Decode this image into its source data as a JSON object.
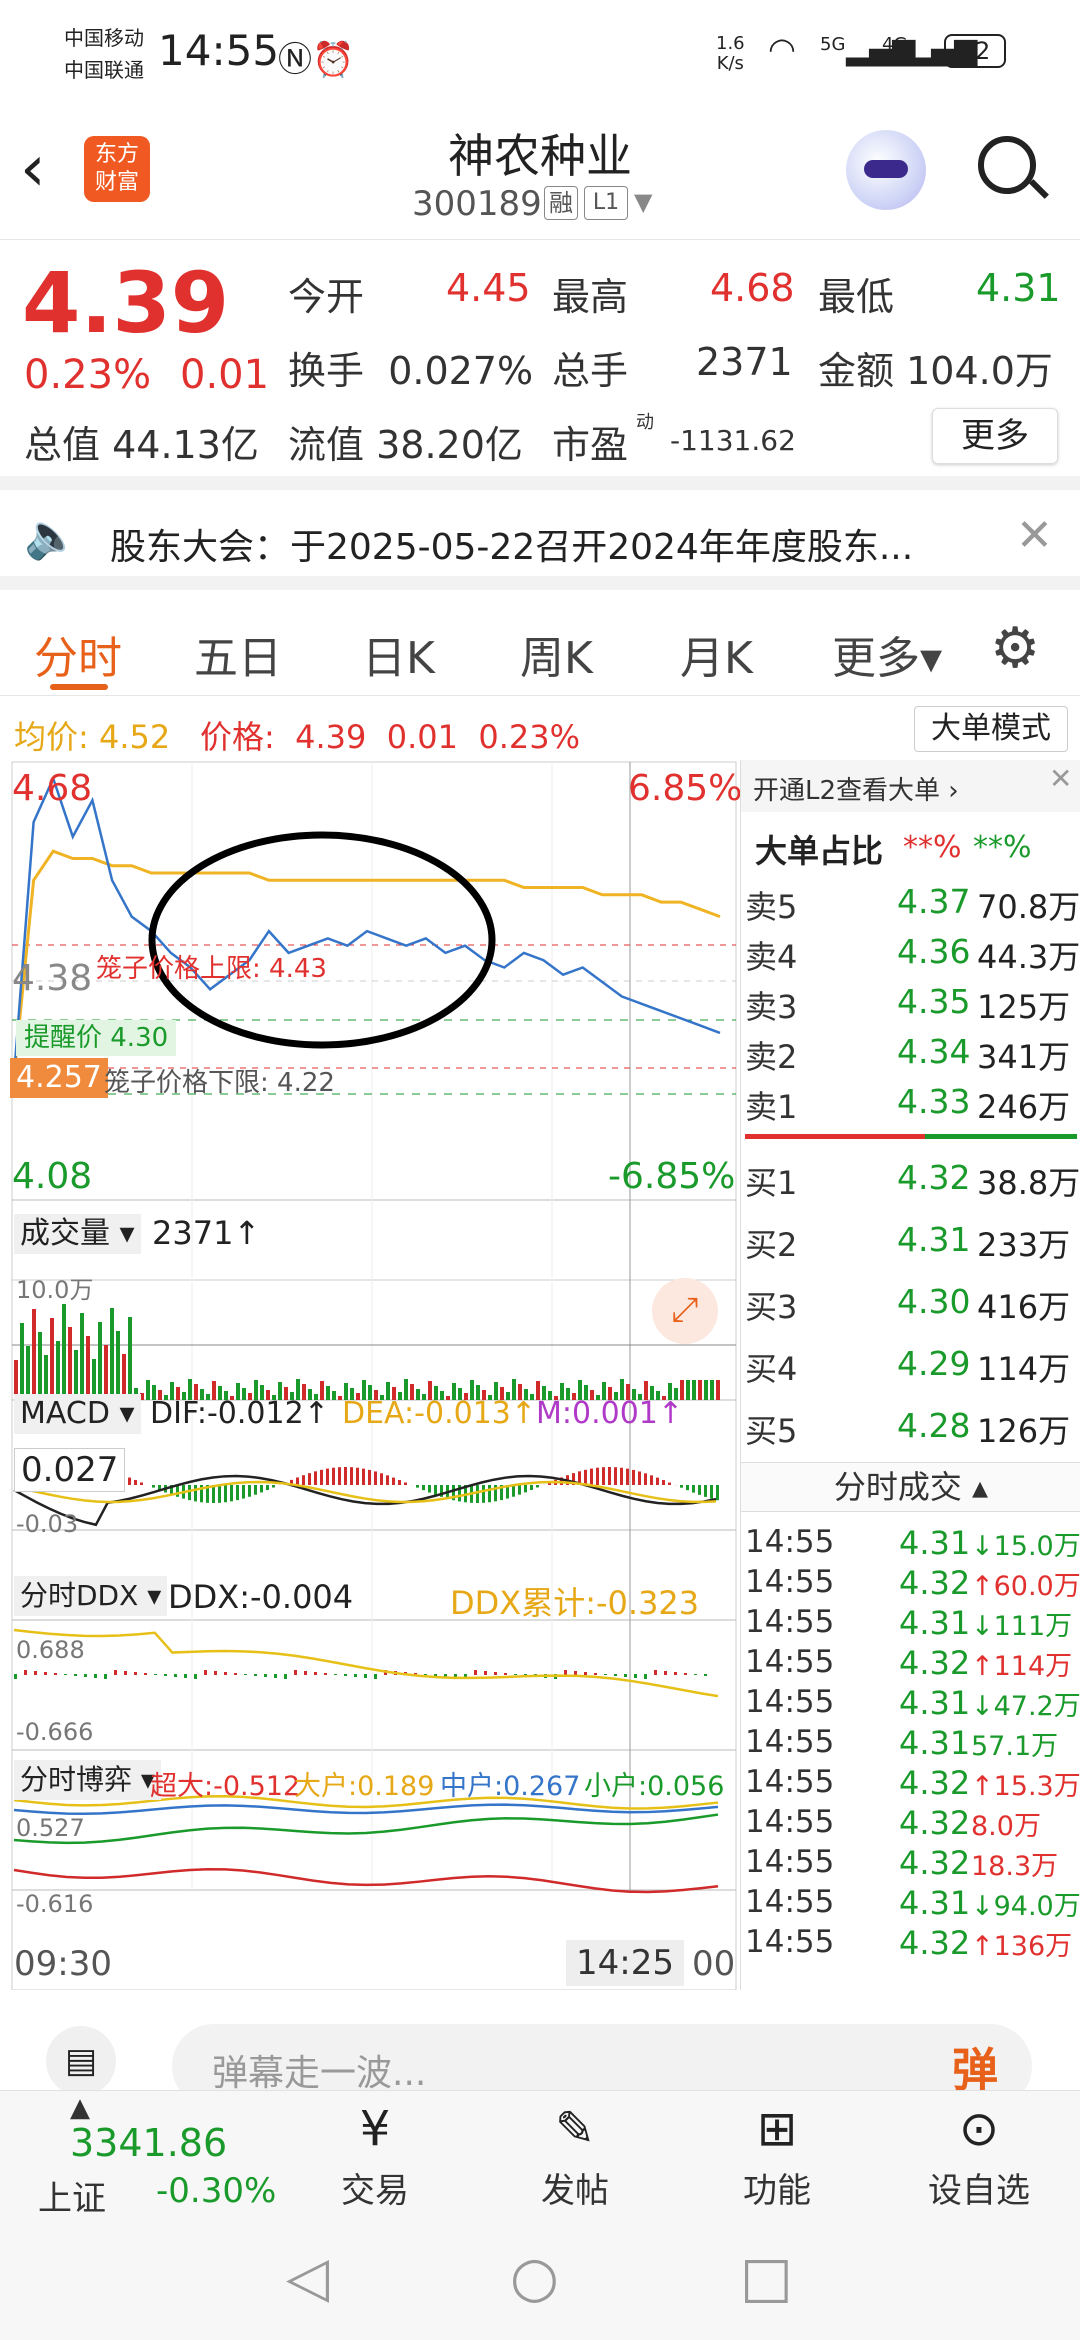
{
  "status": {
    "carrier1": "中国移动",
    "carrier2": "中国联通",
    "time": "14:55",
    "speed_top": "1.6",
    "speed_bottom": "K/s",
    "net1": "5G",
    "net2": "4G",
    "battery": "12"
  },
  "header": {
    "logo_line1": "东方",
    "logo_line2": "财富",
    "title": "神农种业",
    "code": "300189",
    "tag_rong": "融",
    "tag_l1": "L1"
  },
  "quote": {
    "price": "4.39",
    "pct": "0.23%",
    "chg": "0.01",
    "open_label": "今开",
    "open": "4.45",
    "high_label": "最高",
    "high": "4.68",
    "low_label": "最低",
    "low": "4.31",
    "turnover_label": "换手",
    "turnover": "0.027%",
    "volume_label": "总手",
    "volume": "2371",
    "amount_label": "金额",
    "amount": "104.0万",
    "mcap_label": "总值",
    "mcap": "44.13亿",
    "float_label": "流值",
    "float": "38.20亿",
    "pe_label": "市盈",
    "pe_sup": "动",
    "pe": "-1131.62",
    "more_label": "更多"
  },
  "notice": {
    "text": "股东大会：于2025-05-22召开2024年年度股东..."
  },
  "tabs": [
    "分时",
    "五日",
    "日K",
    "周K",
    "月K",
    "更多▾"
  ],
  "chart": {
    "avg_label": "均价:",
    "avg": "4.52",
    "price_label": "价格:",
    "price": "4.39",
    "chg": "0.01",
    "pct": "0.23%",
    "bigorder_btn": "大单模式",
    "y_top": "4.68",
    "y_mid": "4.38",
    "y_bot": "4.08",
    "pct_top": "6.85%",
    "pct_bot": "-6.85%",
    "cage_up": "笼子价格上限:  4.43",
    "cage_down": "笼子价格下限:  4.22",
    "alert": "提醒价 4.30",
    "current_tag": "4.257",
    "vol_label": "成交量",
    "vol_value": "2371↑",
    "vol_scale": "10.0万",
    "macd_label": "MACD",
    "dif": "DIF:-0.012↑",
    "dea": "DEA:-0.013↑",
    "m": "M:0.001↑",
    "macd_top": "0.027",
    "macd_bot": "-0.03",
    "ddx_label": "分时DDX",
    "ddx": "DDX:-0.004",
    "ddx_sum": "DDX累计:-0.323",
    "ddx_top": "0.688",
    "ddx_bot": "-0.666",
    "game_label": "分时博弈",
    "super": "超大:-0.512",
    "big": "大户:0.189",
    "mid": "中户:0.267",
    "small": "小户:0.056",
    "game_top": "0.527",
    "game_bot": "-0.616",
    "t_start": "09:30",
    "t_cross": "14:25",
    "t_end": "00"
  },
  "chart_data": {
    "type": "line",
    "title": "",
    "x": [
      "09:30",
      "15:00"
    ],
    "price_series": [
      4.25,
      4.6,
      4.66,
      4.58,
      4.63,
      4.52,
      4.47,
      4.45,
      4.42,
      4.4,
      4.37,
      4.39,
      4.41,
      4.45,
      4.42,
      4.43,
      4.44,
      4.43,
      4.45,
      4.44,
      4.43,
      4.44,
      4.42,
      4.43,
      4.41,
      4.4,
      4.42,
      4.41,
      4.39,
      4.4,
      4.38,
      4.36,
      4.35,
      4.34,
      4.33,
      4.32,
      4.31
    ],
    "avg_series": [
      4.25,
      4.52,
      4.56,
      4.55,
      4.55,
      4.54,
      4.54,
      4.53,
      4.53,
      4.53,
      4.53,
      4.53,
      4.53,
      4.52,
      4.52,
      4.52,
      4.52,
      4.52,
      4.52,
      4.52,
      4.52,
      4.52,
      4.52,
      4.52,
      4.52,
      4.52,
      4.51,
      4.51,
      4.51,
      4.51,
      4.5,
      4.5,
      4.5,
      4.49,
      4.49,
      4.48,
      4.47
    ],
    "ylim": [
      4.08,
      4.68
    ]
  },
  "orderbook": {
    "promo": "开通L2查看大单 ›",
    "big_label": "大单占比",
    "big_red": "**%",
    "big_green": "**%",
    "asks": [
      {
        "l": "卖5",
        "p": "4.37",
        "v": "70.8万"
      },
      {
        "l": "卖4",
        "p": "4.36",
        "v": "44.3万"
      },
      {
        "l": "卖3",
        "p": "4.35",
        "v": "125万"
      },
      {
        "l": "卖2",
        "p": "4.34",
        "v": "341万"
      },
      {
        "l": "卖1",
        "p": "4.33",
        "v": "246万"
      }
    ],
    "bids": [
      {
        "l": "买1",
        "p": "4.32",
        "v": "38.8万"
      },
      {
        "l": "买2",
        "p": "4.31",
        "v": "233万"
      },
      {
        "l": "买3",
        "p": "4.30",
        "v": "416万"
      },
      {
        "l": "买4",
        "p": "4.29",
        "v": "114万"
      },
      {
        "l": "买5",
        "p": "4.28",
        "v": "126万"
      }
    ],
    "ticks_label": "分时成交 ▴",
    "ticks": [
      {
        "t": "14:55",
        "p": "4.31",
        "a": "↓",
        "v": "15.0万",
        "c": "g"
      },
      {
        "t": "14:55",
        "p": "4.32",
        "a": "↑",
        "v": "60.0万",
        "c": "r"
      },
      {
        "t": "14:55",
        "p": "4.31",
        "a": "↓",
        "v": "111万",
        "c": "g"
      },
      {
        "t": "14:55",
        "p": "4.32",
        "a": "↑",
        "v": "114万",
        "c": "r"
      },
      {
        "t": "14:55",
        "p": "4.31",
        "a": "↓",
        "v": "47.2万",
        "c": "g"
      },
      {
        "t": "14:55",
        "p": "4.31",
        "a": "",
        "v": "57.1万",
        "c": "g"
      },
      {
        "t": "14:55",
        "p": "4.32",
        "a": "↑",
        "v": "15.3万",
        "c": "r"
      },
      {
        "t": "14:55",
        "p": "4.32",
        "a": "",
        "v": "8.0万",
        "c": "r"
      },
      {
        "t": "14:55",
        "p": "4.32",
        "a": "",
        "v": "18.3万",
        "c": "r"
      },
      {
        "t": "14:55",
        "p": "4.31",
        "a": "↓",
        "v": "94.0万",
        "c": "g"
      },
      {
        "t": "14:55",
        "p": "4.32",
        "a": "↑",
        "v": "136万",
        "c": "r"
      }
    ]
  },
  "danmaku": {
    "placeholder": "弹幕走一波...",
    "btn": "弹"
  },
  "bottom": {
    "index_value": "3341.86",
    "index_name": "上证",
    "index_pct": "-0.30%",
    "trade": "交易",
    "post": "发帖",
    "func": "功能",
    "watch": "设自选"
  }
}
